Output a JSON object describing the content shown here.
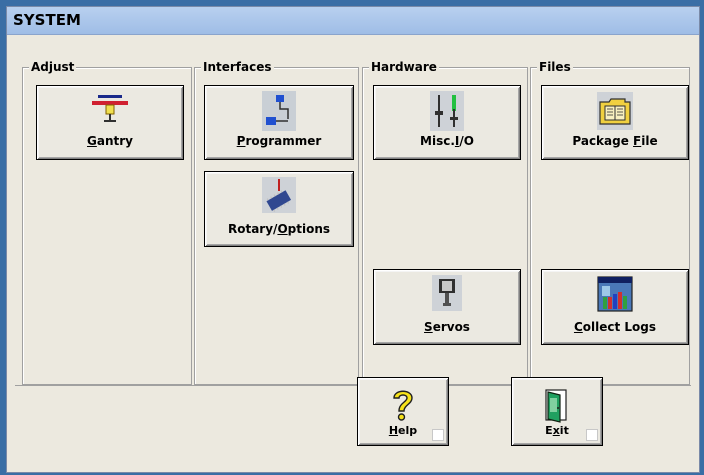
{
  "window": {
    "title": "SYSTEM"
  },
  "groups": {
    "adjust": {
      "label": "Adjust"
    },
    "interfaces": {
      "label": "Interfaces"
    },
    "hardware": {
      "label": "Hardware"
    },
    "files": {
      "label": "Files"
    }
  },
  "buttons": {
    "gantry": {
      "label_pre": "",
      "label_u": "G",
      "label_post": "antry"
    },
    "programmer": {
      "label_pre": "",
      "label_u": "P",
      "label_post": "rogrammer"
    },
    "rotary": {
      "label_pre": "Rotary/",
      "label_u": "O",
      "label_post": "ptions"
    },
    "misc_io": {
      "label_pre": "Misc.",
      "label_u": "I",
      "label_post": "/O"
    },
    "servos": {
      "label_pre": "",
      "label_u": "S",
      "label_post": "ervos"
    },
    "package_file": {
      "label_pre": "Package ",
      "label_u": "F",
      "label_post": "ile"
    },
    "collect_logs": {
      "label_pre": "",
      "label_u": "C",
      "label_post": "ollect Logs"
    },
    "help": {
      "label_pre": "",
      "label_u": "H",
      "label_post": "elp"
    },
    "exit": {
      "label_pre": "E",
      "label_u": "x",
      "label_post": "it"
    }
  },
  "icons": {
    "gantry": "gantry-icon",
    "programmer": "programmer-icon",
    "rotary": "chip-icon",
    "misc_io": "io-slider-icon",
    "servos": "servo-icon",
    "package_file": "package-folder-icon",
    "collect_logs": "logs-icon",
    "help": "question-mark-icon",
    "exit": "exit-door-icon"
  },
  "colors": {
    "title_bar": "#9fbde6",
    "face": "#ece9df",
    "help_yellow": "#f6e21a",
    "io_green": "#22c040"
  }
}
